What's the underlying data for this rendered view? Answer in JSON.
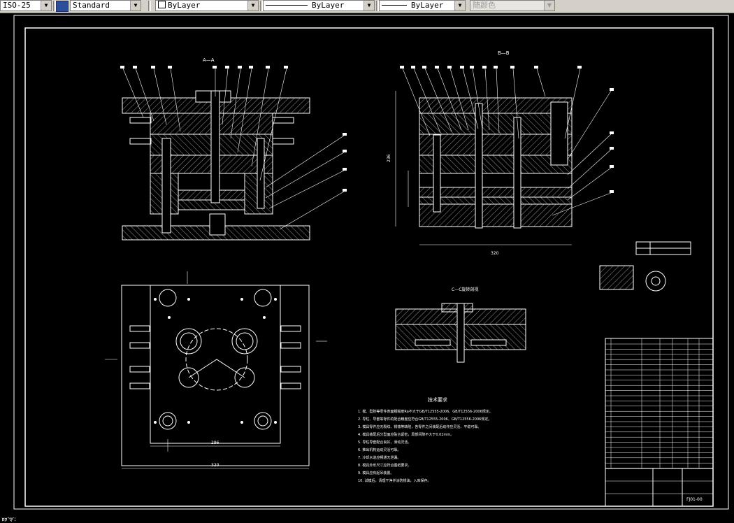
{
  "toolbar": {
    "dimstyle": "ISO-25",
    "textstyle": "Standard",
    "layer_color": "ByLayer",
    "linetype": "ByLayer",
    "lineweight": "ByLayer",
    "plotstyle": "随颜色"
  },
  "drawing": {
    "section_aa": "A—A",
    "section_bb": "B—B",
    "section_cc": "C—C旋转剖视",
    "dim_width_side": "320",
    "dim_height": "236",
    "dim_width_top": "296",
    "dim_width_plan": "320",
    "tech_req_title": "技术要求",
    "tech_req_lines": [
      "1. 模、型腔等零件表面粗糙度Ra不大于GB/T12555-2006、GB/T12556-2006规定。",
      "2. 导柱、导套等零件的配合精度应符合GB/T12555-2006、GB/T12556-2006规定。",
      "3. 模具零件应无裂纹、锈蚀等缺陷，各零件之间装配后动作应灵活、平稳可靠。",
      "4. 模具装配后分型面应贴合紧密，局部间隙不大于0.02mm。",
      "5. 导柱导套配合良好，滑动灵活。",
      "6. 推出机构运动灵活可靠。",
      "7. 冷却水道应畅通无泄漏。",
      "8. 模具外形尺寸应符合图纸要求。",
      "9. 模具应有起吊装置。",
      "10. 试模后，清理干净并涂防锈油，入库保存。"
    ],
    "title_block": "FJ01-00"
  },
  "status": {
    "command_line": "命令:"
  }
}
